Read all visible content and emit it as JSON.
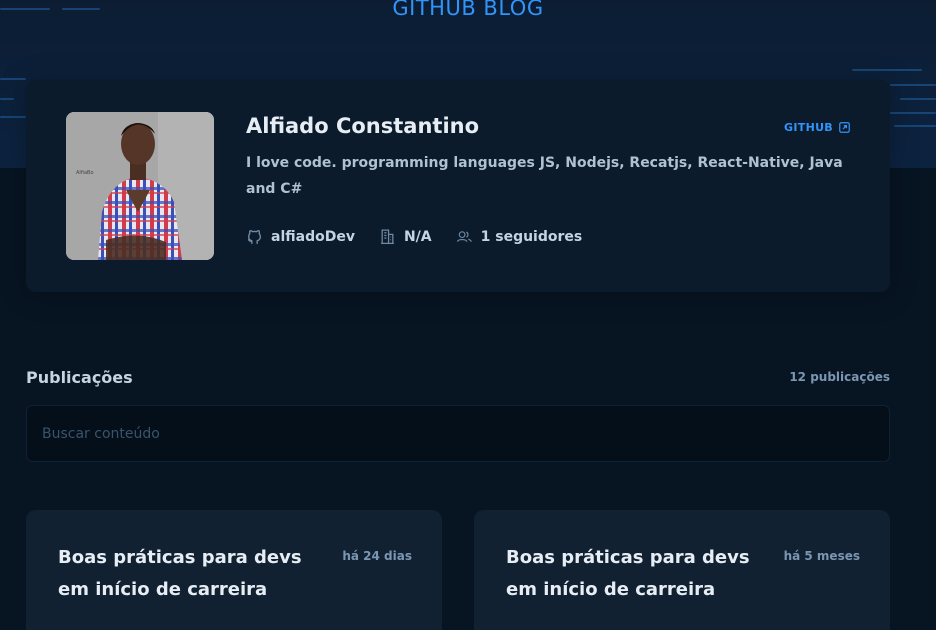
{
  "header": {
    "brand": "GITHUB BLOG"
  },
  "profile": {
    "name": "Alfiado Constantino",
    "bio": "I love code. programming languages JS, Nodejs, Recatjs, React-Native, Java and C#",
    "github_link_label": "GITHUB",
    "username": "alfiadoDev",
    "company": "N/A",
    "followers": "1 seguidores"
  },
  "publications": {
    "title": "Publicações",
    "count": "12 publicações",
    "search_placeholder": "Buscar conteúdo",
    "posts": [
      {
        "title": "Boas práticas para devs em início de carreira",
        "date": "há 24 dias"
      },
      {
        "title": "Boas práticas para devs em início de carreira",
        "date": "há 5 meses"
      }
    ]
  },
  "colors": {
    "accent": "#3294f8",
    "background": "#071422",
    "profile_bg": "#0b1b2b",
    "card_bg": "#112131"
  }
}
